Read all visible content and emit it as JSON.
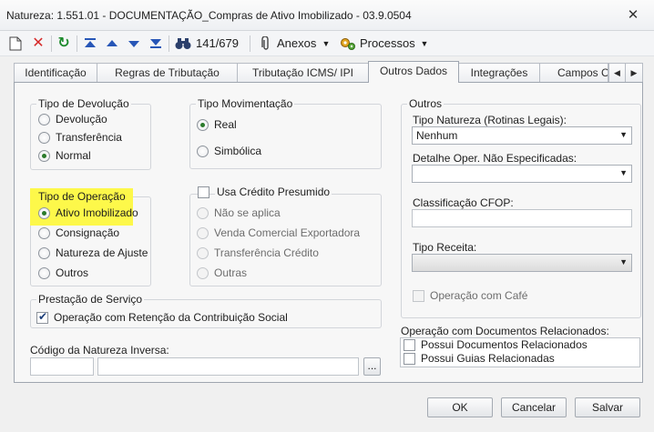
{
  "window": {
    "title": "Natureza: 1.551.01 - DOCUMENTAÇÃO_Compras de Ativo Imobilizado - 03.9.0504",
    "close_symbol": "✕"
  },
  "toolbar": {
    "record_counter": "141/679",
    "anexos_label": "Anexos",
    "processos_label": "Processos"
  },
  "tabs": [
    {
      "label": "Identificação"
    },
    {
      "label": "Regras de Tributação"
    },
    {
      "label": "Tributação ICMS/ IPI"
    },
    {
      "label": "Outros Dados"
    },
    {
      "label": "Integrações"
    },
    {
      "label": "Campos C"
    }
  ],
  "tipo_devolucao": {
    "title": "Tipo de Devolução",
    "options": [
      "Devolução",
      "Transferência",
      "Normal"
    ],
    "selected": "Normal"
  },
  "tipo_movimentacao": {
    "title": "Tipo Movimentação",
    "options": [
      "Real",
      "Simbólica"
    ],
    "selected": "Real"
  },
  "tipo_operacao": {
    "title": "Tipo de Operação",
    "options": [
      "Ativo Imobilizado",
      "Consignação",
      "Natureza de Ajuste",
      "Outros"
    ],
    "selected": "Ativo Imobilizado"
  },
  "credito_presumido": {
    "checkbox_label": "Usa Crédito Presumido",
    "options": [
      "Não se aplica",
      "Venda Comercial Exportadora",
      "Transferência Crédito",
      "Outras"
    ]
  },
  "prestacao_servico": {
    "title": "Prestação de Serviço",
    "checkbox_label": "Operação com Retenção da Contribuição Social",
    "checked": true
  },
  "codigo_natureza_inversa": {
    "label": "Código da Natureza Inversa:",
    "lookup_label": "..."
  },
  "outros": {
    "title": "Outros",
    "tipo_natureza_label": "Tipo Natureza (Rotinas Legais):",
    "tipo_natureza_value": "Nenhum",
    "detalhe_label": "Detalhe Oper. Não Especificadas:",
    "cfop_label": "Classificação CFOP:",
    "tipo_receita_label": "Tipo Receita:",
    "operacao_cafe_label": "Operação com Café"
  },
  "docs_relacionados": {
    "title": "Operação com Documentos Relacionados:",
    "items": [
      "Possui Documentos Relacionados",
      "Possui Guias Relacionadas"
    ]
  },
  "buttons": {
    "ok": "OK",
    "cancel": "Cancelar",
    "save": "Salvar"
  },
  "colors": {
    "highlight": "#fdf84a",
    "radio_selected": "#2b7a2b"
  }
}
